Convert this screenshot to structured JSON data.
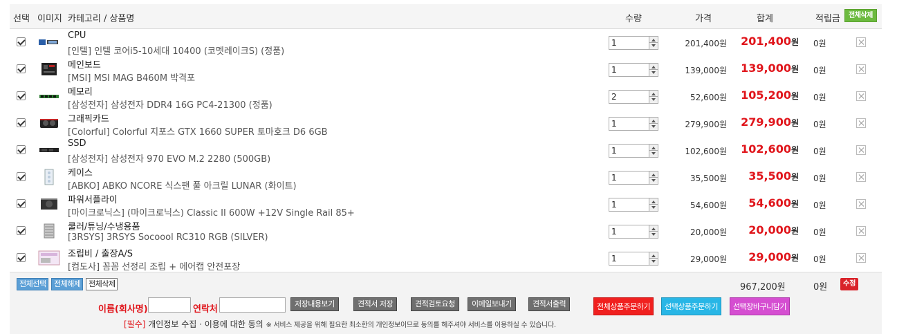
{
  "header": {
    "select": "선택",
    "image": "이미지",
    "name": "카테고리 / 상품명",
    "qty": "수량",
    "price": "가격",
    "total": "합계",
    "point": "적립금",
    "delete_all": "전체삭제"
  },
  "items": [
    {
      "category": "CPU",
      "name": "[인텔] 인텔 코어i5-10세대 10400 (코멧레이크S) (정품)",
      "qty": "1",
      "price": "201,400원",
      "total": "201,400",
      "point": "0원"
    },
    {
      "category": "메인보드",
      "name": "[MSI] MSI MAG B460M 박격포",
      "qty": "1",
      "price": "139,000원",
      "total": "139,000",
      "point": "0원"
    },
    {
      "category": "메모리",
      "name": "[삼성전자] 삼성전자 DDR4 16G PC4-21300 (정품)",
      "qty": "2",
      "price": "52,600원",
      "total": "105,200",
      "point": "0원"
    },
    {
      "category": "그래픽카드",
      "name": "[Colorful] Colorful 지포스 GTX 1660 SUPER 토마호크 D6 6GB",
      "qty": "1",
      "price": "279,900원",
      "total": "279,900",
      "point": "0원"
    },
    {
      "category": "SSD",
      "name": "[삼성전자] 삼성전자 970 EVO M.2 2280 (500GB)",
      "qty": "1",
      "price": "102,600원",
      "total": "102,600",
      "point": "0원"
    },
    {
      "category": "케이스",
      "name": "[ABKO] ABKO NCORE 식스팬 풀 아크릴 LUNAR (화이트)",
      "qty": "1",
      "price": "35,500원",
      "total": "35,500",
      "point": "0원"
    },
    {
      "category": "파워서플라이",
      "name": "[마이크로닉스] (마이크로닉스) Classic II 600W +12V Single Rail 85+",
      "qty": "1",
      "price": "54,600원",
      "total": "54,600",
      "point": "0원"
    },
    {
      "category": "쿨러/튜닝/수냉용품",
      "name": "[3RSYS] 3RSYS Socoool RC310 RGB (SILVER)",
      "qty": "1",
      "price": "20,000원",
      "total": "20,000",
      "point": "0원"
    },
    {
      "category": "조립비 / 출장A/S",
      "name": "[컴도사] 꼼꼼 선정리 조립 + 에어캡 안전포장",
      "qty": "1",
      "price": "29,000원",
      "total": "29,000",
      "point": "0원"
    }
  ],
  "currency_suffix": "원",
  "footer": {
    "select_all": "전체선택",
    "deselect_all": "전체해제",
    "delete_all": "전체삭제",
    "grand_total": "967,200원",
    "grand_point": "0원",
    "edit": "수정",
    "name_label": "이름(회사명)",
    "contact_label": "연락처",
    "btn_view_saved": "저장내용보기",
    "btn_save_quote": "견적서 저장",
    "btn_review": "견적검토요청",
    "btn_email": "이메일보내기",
    "btn_print": "견적서출력",
    "btn_order_all": "전체상품주문하기",
    "btn_order_selected": "선택상품주문하기",
    "btn_cart": "선택장바구니담기",
    "consent_required": "[필수]",
    "consent_text": " 개인정보 수집 · 이용에 대한 동의 ",
    "consent_note": "※ 서비스 제공을 위해 필요한 최소한의 개인정보이므로 동의를 해주셔야 서비스를 이용하실 수 있습니다."
  },
  "colors": {
    "accent_red": "#e0151b",
    "green": "#6cba3f",
    "blue": "#5b9fd6",
    "cyan": "#28b6e6",
    "pink": "#d54ed1"
  }
}
